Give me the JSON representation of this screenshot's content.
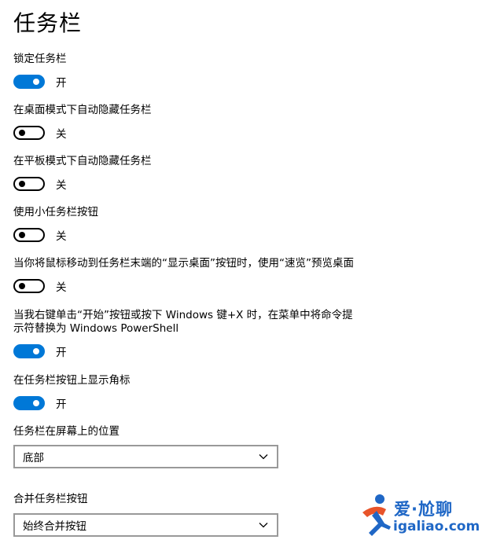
{
  "page": {
    "title": "任务栏"
  },
  "settings": [
    {
      "label": "锁定任务栏",
      "on": true,
      "state": "开"
    },
    {
      "label": "在桌面模式下自动隐藏任务栏",
      "on": false,
      "state": "关"
    },
    {
      "label": "在平板模式下自动隐藏任务栏",
      "on": false,
      "state": "关"
    },
    {
      "label": "使用小任务栏按钮",
      "on": false,
      "state": "关"
    },
    {
      "label": "当你将鼠标移动到任务栏末端的“显示桌面”按钮时，使用“速览”预览桌面",
      "on": false,
      "state": "关"
    },
    {
      "label": "当我右键单击“开始”按钮或按下 Windows 键+X 时，在菜单中将命令提\n示符替换为 Windows PowerShell",
      "on": true,
      "state": "开"
    },
    {
      "label": "在任务栏按钮上显示角标",
      "on": true,
      "state": "开"
    }
  ],
  "position": {
    "label": "任务栏在屏幕上的位置",
    "value": "底部"
  },
  "combine": {
    "label": "合并任务栏按钮",
    "value": "始终合并按钮"
  },
  "watermark": {
    "line1": "爱·尬聊",
    "line2": "igaliao.com"
  },
  "colors": {
    "accent": "#0078d7",
    "watermark": "#1f67c6",
    "watermark_accent": "#e8542a"
  }
}
